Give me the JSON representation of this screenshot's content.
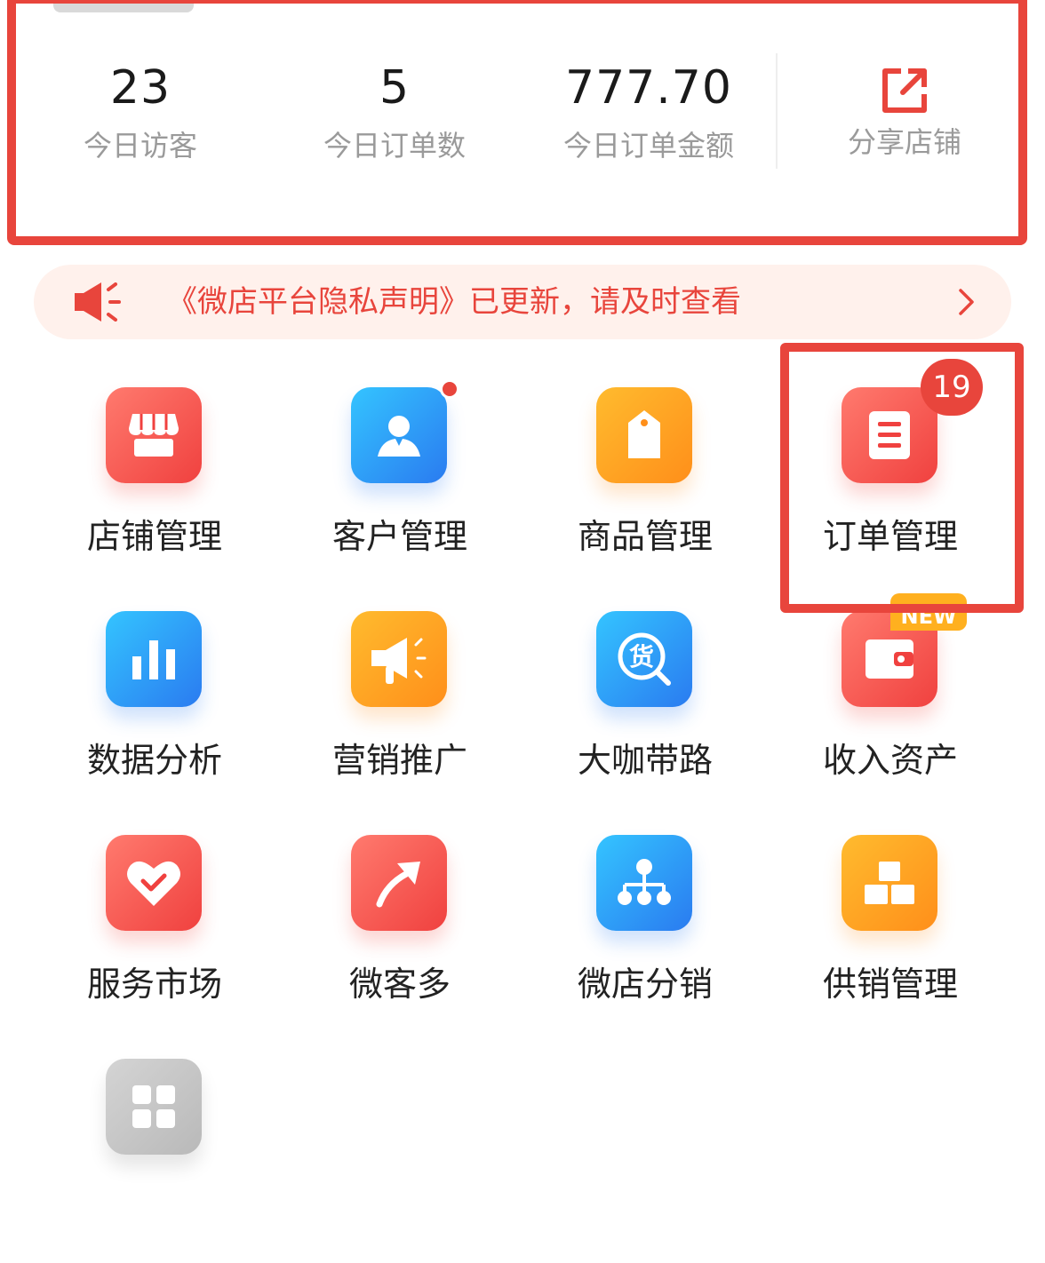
{
  "stats": [
    {
      "value": "23",
      "label": "今日访客"
    },
    {
      "value": "5",
      "label": "今日订单数"
    },
    {
      "value": "777.70",
      "label": "今日订单金额"
    }
  ],
  "share": {
    "label": "分享店铺",
    "icon": "share-icon"
  },
  "notice": {
    "text": "《微店平台隐私声明》已更新，请及时查看",
    "icon": "speaker-icon"
  },
  "grid": [
    {
      "label": "店铺管理",
      "icon": "store-icon"
    },
    {
      "label": "客户管理",
      "icon": "user-icon"
    },
    {
      "label": "商品管理",
      "icon": "tag-icon"
    },
    {
      "label": "订单管理",
      "icon": "document-icon",
      "badge": "19"
    },
    {
      "label": "数据分析",
      "icon": "bar-chart-icon"
    },
    {
      "label": "营销推广",
      "icon": "megaphone-icon"
    },
    {
      "label": "大咖带路",
      "icon": "search-goods-icon",
      "glyph": "货"
    },
    {
      "label": "收入资产",
      "icon": "wallet-icon",
      "tag": "NEW"
    },
    {
      "label": "服务市场",
      "icon": "heart-check-icon"
    },
    {
      "label": "微客多",
      "icon": "arrow-up-icon"
    },
    {
      "label": "微店分销",
      "icon": "hierarchy-icon"
    },
    {
      "label": "供销管理",
      "icon": "boxes-icon"
    },
    {
      "label": "",
      "icon": "apps-grid-icon"
    }
  ],
  "colors": {
    "accent": "#e8453c",
    "blue": "#2a7bf0",
    "orange": "#ff8f1a"
  }
}
